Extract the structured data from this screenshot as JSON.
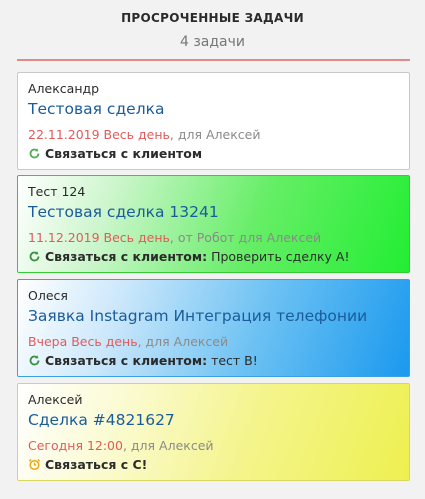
{
  "header": {
    "title": "ПРОСРОЧЕННЫЕ ЗАДАЧИ",
    "count": "4 задачи"
  },
  "colors": {
    "accent_line": "#e08a8a",
    "deal_link": "#1a5c9a",
    "overdue_date": "#e15b5b",
    "card2_bg": "#22ee33",
    "card3_bg": "#1a99ee",
    "card4_bg": "#eef050"
  },
  "tasks": [
    {
      "contact": "Александр",
      "deal": "Тестовая сделка",
      "date": "22.11.2019 Весь день",
      "meta": ", для Алексей",
      "icon": "refresh-icon",
      "type": "Связаться с клиентом",
      "text": ""
    },
    {
      "contact": "Тест 124",
      "deal": "Тестовая сделка 13241",
      "date": "11.12.2019 Весь день",
      "meta": ", от Робот для Алексей",
      "icon": "refresh-icon",
      "type": "Связаться с клиентом:",
      "text": "Проверить сделку А!"
    },
    {
      "contact": "Олеся",
      "deal": "Заявка Instagram Интеграция телефонии",
      "date": "Вчера Весь день",
      "meta": ", для Алексей",
      "icon": "refresh-icon",
      "type": "Связаться с клиентом:",
      "text": "тест В!"
    },
    {
      "contact": "Алексей",
      "deal": "Сделка #4821627",
      "date": "Сегодня 12:00",
      "meta": ", для Алексей",
      "icon": "alarm-clock-icon",
      "type": "Связаться с С!",
      "text": ""
    }
  ]
}
